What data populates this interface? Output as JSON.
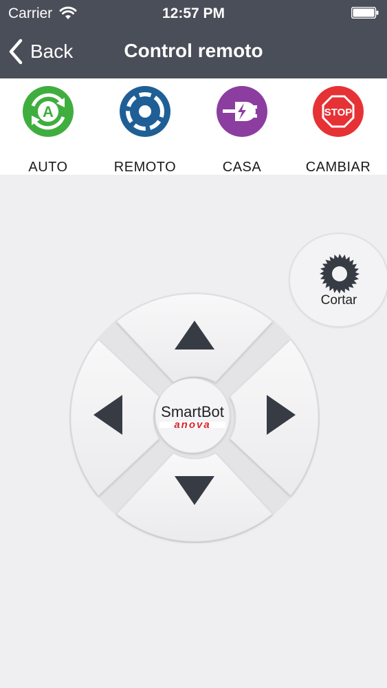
{
  "status_bar": {
    "carrier": "Carrier",
    "time": "12:57 PM"
  },
  "nav": {
    "back_label": "Back",
    "title": "Control remoto"
  },
  "modes": [
    {
      "label": "AUTO",
      "icon": "auto-mode-icon",
      "color": "#3fae3f"
    },
    {
      "label": "REMOTO",
      "icon": "remote-mode-icon",
      "color": "#1f5f96"
    },
    {
      "label": "CASA",
      "icon": "home-charge-icon",
      "color": "#8c3da0"
    },
    {
      "label": "CAMBIAR",
      "icon": "stop-sign-icon",
      "color": "#e63235",
      "icon_text": "STOP"
    }
  ],
  "cut": {
    "label": "Cortar",
    "icon": "saw-blade-icon"
  },
  "dpad": {
    "up_icon": "arrow-up-icon",
    "down_icon": "arrow-down-icon",
    "left_icon": "arrow-left-icon",
    "right_icon": "arrow-right-icon"
  },
  "logo": {
    "brand": "SmartBot",
    "sub": "anova",
    "sub_color": "#d8232a"
  },
  "colors": {
    "bar": "#4a4e58",
    "arrow": "#363b44",
    "background": "#efeff1"
  }
}
